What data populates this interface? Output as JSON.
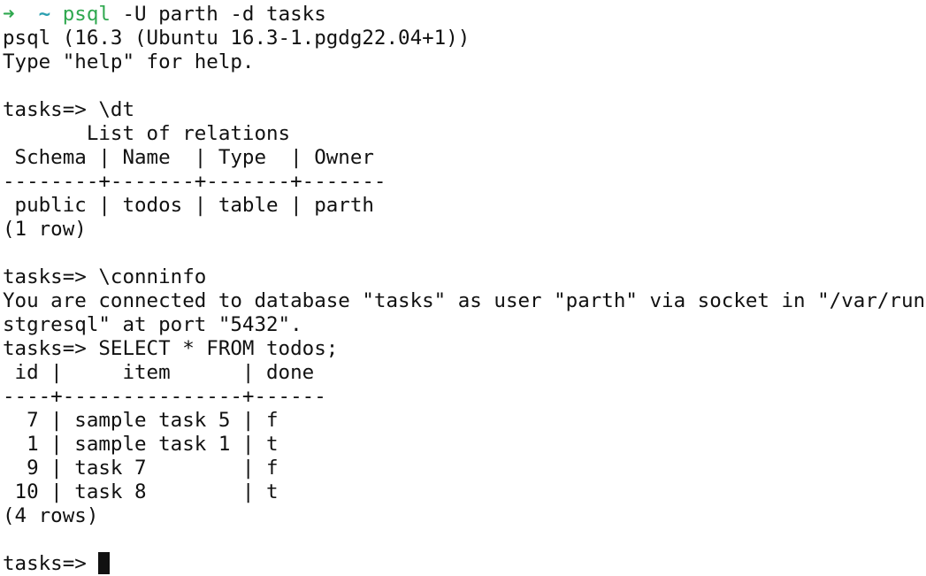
{
  "shell_prompt": {
    "arrow_glyph": "➜",
    "dir": "~",
    "command_name": "psql",
    "command_args": " -U parth -d tasks",
    "colors": {
      "arrow": "#2fa84f",
      "dir": "#2a9fb0",
      "command": "#2fa84f"
    }
  },
  "lines": [
    "psql (16.3 (Ubuntu 16.3-1.pgdg22.04+1))",
    "Type \"help\" for help.",
    "",
    "tasks=> \\dt",
    "       List of relations",
    " Schema | Name  | Type  | Owner",
    "--------+-------+-------+-------",
    " public | todos | table | parth",
    "(1 row)",
    "",
    "tasks=> \\conninfo",
    "You are connected to database \"tasks\" as user \"parth\" via socket in \"/var/run/po",
    "stgresql\" at port \"5432\".",
    "tasks=> SELECT * FROM todos;",
    " id |     item      | done",
    "----+---------------+------",
    "  7 | sample task 5 | f",
    "  1 | sample task 1 | t",
    "  9 | task 7        | f",
    " 10 | task 8        | t",
    "(4 rows)",
    ""
  ],
  "final_prompt": "tasks=> "
}
